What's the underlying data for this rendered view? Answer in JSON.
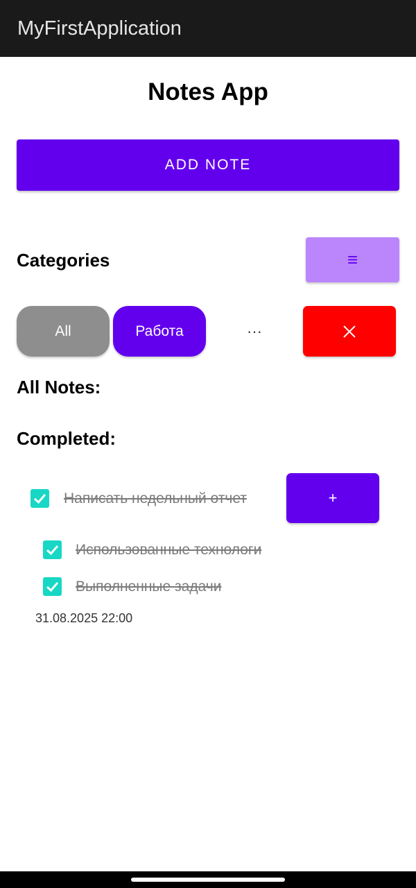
{
  "app_bar": {
    "title": "MyFirstApplication"
  },
  "main": {
    "title": "Notes App",
    "add_note_label": "ADD NOTE",
    "categories_label": "Categories",
    "menu_icon_glyph": "≡",
    "chips": [
      {
        "label": "All",
        "color": "#8e8e8e"
      },
      {
        "label": "Работа",
        "color": "#6200ee"
      }
    ],
    "more_icon_glyph": "···",
    "delete_icon": "close-icon",
    "all_notes_label": "All Notes:",
    "completed_label": "Completed:"
  },
  "completed_note": {
    "title": "Написать недельный отчет",
    "checked": true,
    "add_button_label": "+",
    "subtasks": [
      {
        "text": "Использованные технологи",
        "checked": true
      },
      {
        "text": "Выполненные задачи",
        "checked": true
      }
    ],
    "timestamp": "31.08.2025 22:00"
  },
  "colors": {
    "primary": "#6200ee",
    "primary_light": "#bb86fc",
    "checkbox": "#18d7c5",
    "delete": "#ff0000",
    "chip_inactive": "#8e8e8e"
  }
}
